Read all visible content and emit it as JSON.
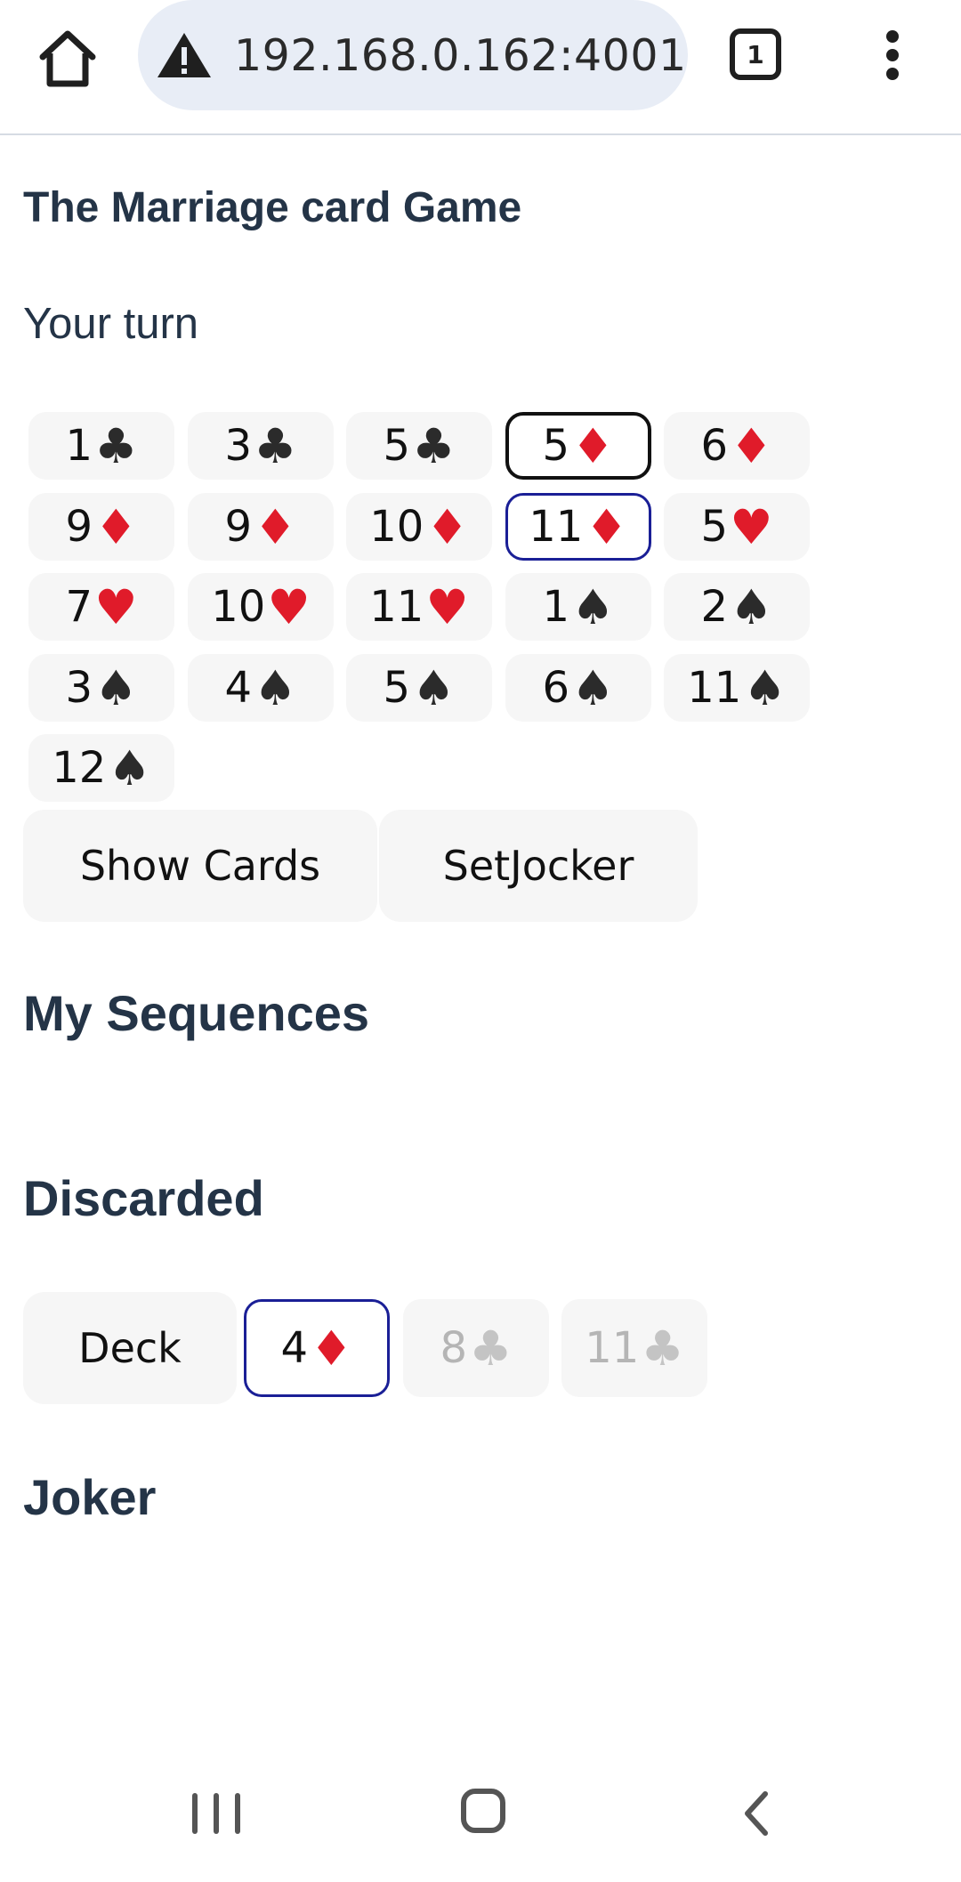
{
  "browser": {
    "url": "192.168.0.162:4001",
    "tab_count": "1",
    "icons": [
      "home-icon",
      "warning-icon",
      "tabs-icon",
      "menu-dots-icon"
    ]
  },
  "page": {
    "title": "The Marriage card Game",
    "turn_status": "Your turn"
  },
  "hand": [
    {
      "rank": "1",
      "suit": "♣",
      "suit_name": "club",
      "state": "normal"
    },
    {
      "rank": "3",
      "suit": "♣",
      "suit_name": "club",
      "state": "normal"
    },
    {
      "rank": "5",
      "suit": "♣",
      "suit_name": "club",
      "state": "normal"
    },
    {
      "rank": "5",
      "suit": "♦",
      "suit_name": "diamond",
      "state": "selected-black"
    },
    {
      "rank": "6",
      "suit": "♦",
      "suit_name": "diamond",
      "state": "normal"
    },
    {
      "rank": "9",
      "suit": "♦",
      "suit_name": "diamond",
      "state": "normal"
    },
    {
      "rank": "9",
      "suit": "♦",
      "suit_name": "diamond",
      "state": "normal"
    },
    {
      "rank": "10",
      "suit": "♦",
      "suit_name": "diamond",
      "state": "normal"
    },
    {
      "rank": "11",
      "suit": "♦",
      "suit_name": "diamond",
      "state": "selected-blue"
    },
    {
      "rank": "5",
      "suit": "♥",
      "suit_name": "heart",
      "state": "normal"
    },
    {
      "rank": "7",
      "suit": "♥",
      "suit_name": "heart",
      "state": "normal"
    },
    {
      "rank": "10",
      "suit": "♥",
      "suit_name": "heart",
      "state": "normal"
    },
    {
      "rank": "11",
      "suit": "♥",
      "suit_name": "heart",
      "state": "normal"
    },
    {
      "rank": "1",
      "suit": "♠",
      "suit_name": "spade",
      "state": "normal"
    },
    {
      "rank": "2",
      "suit": "♠",
      "suit_name": "spade",
      "state": "normal"
    },
    {
      "rank": "3",
      "suit": "♠",
      "suit_name": "spade",
      "state": "normal"
    },
    {
      "rank": "4",
      "suit": "♠",
      "suit_name": "spade",
      "state": "normal"
    },
    {
      "rank": "5",
      "suit": "♠",
      "suit_name": "spade",
      "state": "normal"
    },
    {
      "rank": "6",
      "suit": "♠",
      "suit_name": "spade",
      "state": "normal"
    },
    {
      "rank": "11",
      "suit": "♠",
      "suit_name": "spade",
      "state": "normal"
    },
    {
      "rank": "12",
      "suit": "♠",
      "suit_name": "spade",
      "state": "normal"
    }
  ],
  "actions": {
    "show_cards": "Show Cards",
    "set_joker": "SetJocker"
  },
  "sections": {
    "sequences": "My Sequences",
    "discarded": "Discarded",
    "joker": "Joker"
  },
  "discard_area": {
    "deck_label": "Deck",
    "cards": [
      {
        "rank": "4",
        "suit": "♦",
        "suit_name": "diamond",
        "state": "selected-blue"
      },
      {
        "rank": "8",
        "suit": "♣",
        "suit_name": "club",
        "state": "dim"
      },
      {
        "rank": "11",
        "suit": "♣",
        "suit_name": "club",
        "state": "dim"
      }
    ]
  },
  "colors": {
    "heading": "#243447",
    "red_suit": "#e01b2a",
    "black_suit": "#2b2b2b",
    "selection_blue": "#1a1f96",
    "card_bg": "#f6f6f6"
  },
  "android_nav": [
    "recent-apps-icon",
    "home-nav-icon",
    "back-icon"
  ]
}
